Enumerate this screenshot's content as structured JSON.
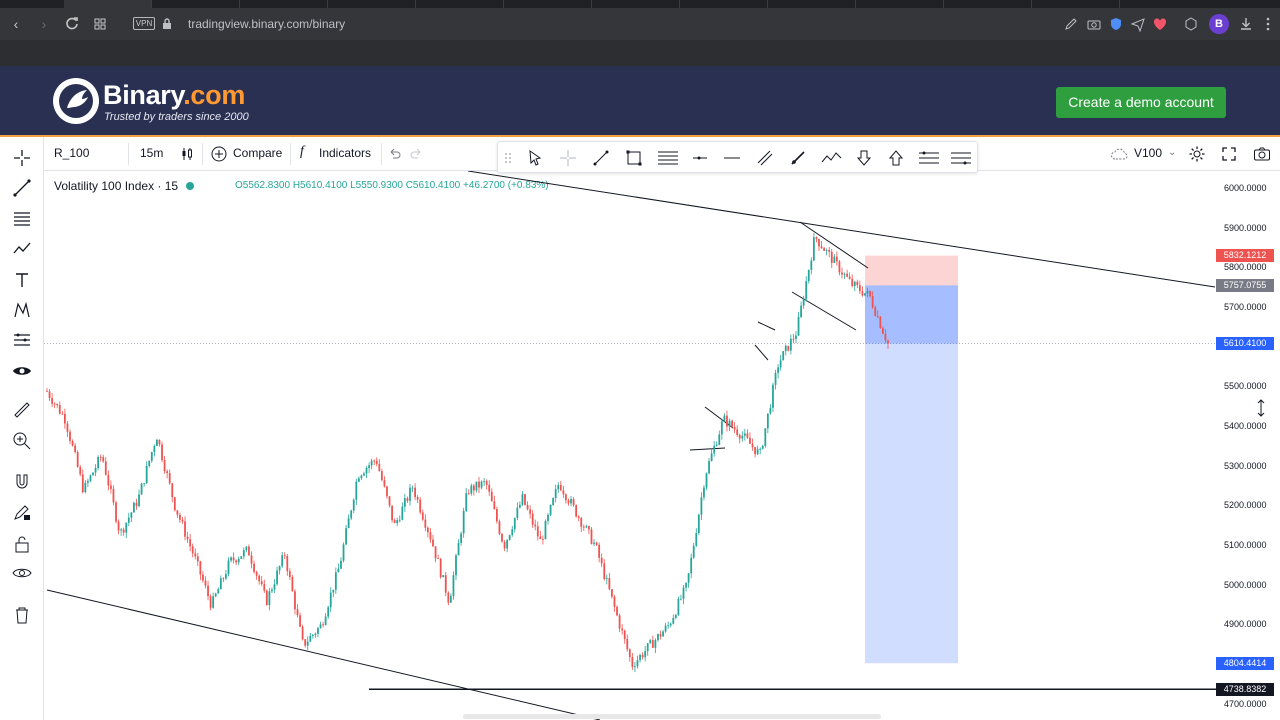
{
  "browser": {
    "url": "tradingview.binary.com/binary",
    "vpn_label": "VPN",
    "profile_initial": "B"
  },
  "site": {
    "logo_name": "Binary",
    "logo_suffix": ".com",
    "tagline": "Trusted by traders since 2000",
    "demo_button": "Create a demo account"
  },
  "toolbar": {
    "symbol": "R_100",
    "interval": "15m",
    "compare": "Compare",
    "indicators": "Indicators",
    "template": "V100"
  },
  "legend": {
    "name": "Volatility 100 Index · 15",
    "ohlc": "O5562.8300 H5610.4100 L5550.9300 C5610.4100 +46.2700 (+0.83%)"
  },
  "price_axis": {
    "ticks": [
      "6000.0000",
      "5900.0000",
      "5800.0000",
      "5700.0000",
      "5500.0000",
      "5400.0000",
      "5300.0000",
      "5200.0000",
      "5100.0000",
      "5000.0000",
      "4900.0000",
      "4700.0000"
    ],
    "labels": {
      "stop": "5832.1212",
      "entry": "5757.0755",
      "last": "5610.4100",
      "target": "4804.4414",
      "hline": "4738.8382"
    },
    "colors": {
      "stop": "#ef5350",
      "entry": "#787b86",
      "last": "#2962ff",
      "target": "#2962ff",
      "hline": "#131722"
    }
  },
  "chart_data": {
    "type": "candlestick",
    "symbol": "R_100",
    "interval": "15m",
    "ylim": [
      4680,
      6040
    ],
    "series": [
      {
        "name": "Volatility 100 Index",
        "close_path": [
          5490,
          5420,
          5240,
          5330,
          5130,
          5220,
          5380,
          5200,
          5080,
          4950,
          5060,
          5090,
          4960,
          5080,
          4850,
          4900,
          5050,
          5280,
          5320,
          5150,
          5250,
          5120,
          4960,
          5240,
          5260,
          5100,
          5220,
          5110,
          5260,
          5180,
          5100,
          4950,
          4800,
          4850,
          4900,
          5000,
          5280,
          5420,
          5380,
          5330,
          5560,
          5640,
          5880,
          5820,
          5760,
          5730,
          5610
        ]
      }
    ],
    "annotations": {
      "short_position": {
        "entry": 5757.0755,
        "stop": 5832.1212,
        "target": 4804.4414
      },
      "horizontal_line": 4738.8382,
      "trend_lines": [
        "upper descending channel",
        "lower descending channel"
      ]
    }
  }
}
